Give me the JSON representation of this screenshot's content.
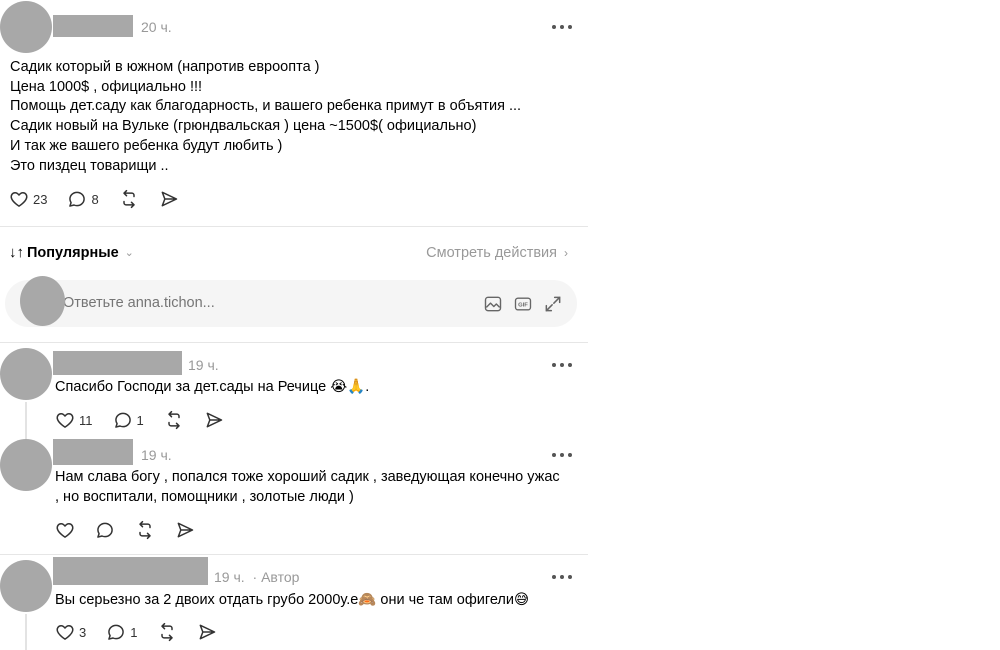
{
  "post": {
    "time": "20 ч.",
    "lines": [
      "Садик который в южном (напротив евроопта )",
      "Цена 1000$ , официально !!!",
      "Помощь дет.саду как благодарность, и вашего ребенка примут в объятия ...",
      "Садик новый на Вульке (грюндвальская ) цена ~1500$( официально)",
      "И так же вашего ребенка будут любить )",
      "Это пиздец товарищи .."
    ],
    "likes": "23",
    "comments": "8"
  },
  "sort": {
    "label": "Популярные"
  },
  "activity": {
    "label": "Смотреть действия"
  },
  "reply": {
    "placeholder": "Ответьте anna.tichon..."
  },
  "icons": {
    "sort": "sort-arrows-icon",
    "chevron": "chevron-right-icon",
    "image": "image-icon",
    "gif": "gif-icon",
    "expand": "expand-icon",
    "more": "more-dots-icon",
    "like": "heart-icon",
    "comment": "comment-icon",
    "repost": "repost-icon",
    "share": "send-icon"
  },
  "replies": [
    {
      "time": "19 ч.",
      "author_tag": "",
      "lines": [
        "Спасибо Господи за дет.сады на Речице 😭🙏."
      ],
      "likes": "11",
      "comments": "1"
    },
    {
      "time": "19 ч.",
      "author_tag": "",
      "lines": [
        "Нам слава богу , попался тоже хороший садик , заведующая конечно ужас",
        ", но воспитали, помощники , золотые люди )"
      ],
      "likes": "",
      "comments": ""
    },
    {
      "time": "19 ч.",
      "author_tag": "· Автор",
      "lines": [
        "Вы серьезно за 2 двоих отдать грубо 2000у.е🙈 они че там офигели😅"
      ],
      "likes": "3",
      "comments": "1"
    }
  ],
  "colors": {
    "text": "#000000",
    "meta": "#999999",
    "placeholder_fill": "#a8a8a8",
    "divider": "#e6e6e6",
    "reply_box": "#f5f5f5"
  }
}
